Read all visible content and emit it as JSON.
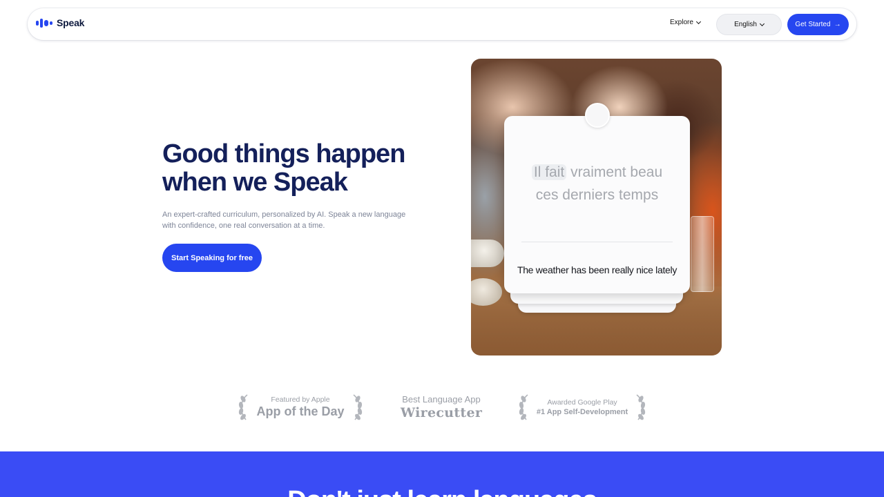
{
  "nav": {
    "logo_text": "Speak",
    "explore_label": "Explore",
    "language_label": "English",
    "cta_label": "Get Started",
    "cta_arrow": "→"
  },
  "hero": {
    "title": "Good things happen when we Speak",
    "subtitle": "An expert-crafted curriculum, personalized by AI. Speak a new language with confidence, one real conversation at a time.",
    "cta_label": "Start Speaking for free"
  },
  "card": {
    "target_highlight": "Il fait",
    "target_rest_line1": "vraiment beau",
    "target_line2": "ces derniers temps",
    "translation": "The weather has been really nice lately"
  },
  "awards": [
    {
      "small": "Featured by Apple",
      "big": "App of the Day"
    },
    {
      "small": "Best Language App",
      "big": "Wirecutter"
    },
    {
      "small": "Awarded Google Play",
      "big": "#1 App Self-Development"
    }
  ],
  "band": {
    "title": "Don't just learn languages"
  },
  "colors": {
    "brand_blue": "#2646f0",
    "band_blue": "#3a4cf5",
    "heading_navy": "#14205a"
  }
}
